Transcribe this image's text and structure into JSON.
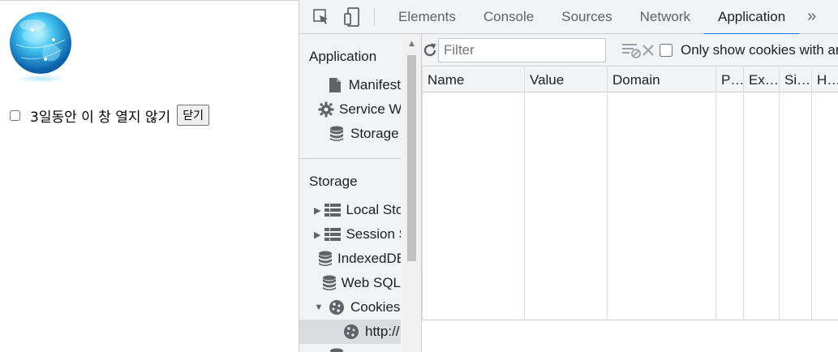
{
  "page": {
    "checkbox_label": "3일동안 이 창 열지 않기",
    "close_button": "닫기"
  },
  "devtools": {
    "tabs": [
      "Elements",
      "Console",
      "Sources",
      "Network",
      "Application"
    ],
    "active_tab": "Application",
    "more_tabs": "»",
    "sidebar": {
      "application_header": "Application",
      "application_items": [
        "Manifest",
        "Service Workers",
        "Storage"
      ],
      "storage_header": "Storage",
      "storage_items": [
        "Local Storage",
        "Session Storage",
        "IndexedDB",
        "Web SQL",
        "Cookies",
        "http://"
      ],
      "selected_item": "http://"
    },
    "cookies": {
      "filter_placeholder": "Filter",
      "only_show_label": "Only show cookies with an issue",
      "columns": [
        "Name",
        "Value",
        "Domain",
        "Path",
        "Expires",
        "Size",
        "HttpOnly"
      ]
    }
  }
}
